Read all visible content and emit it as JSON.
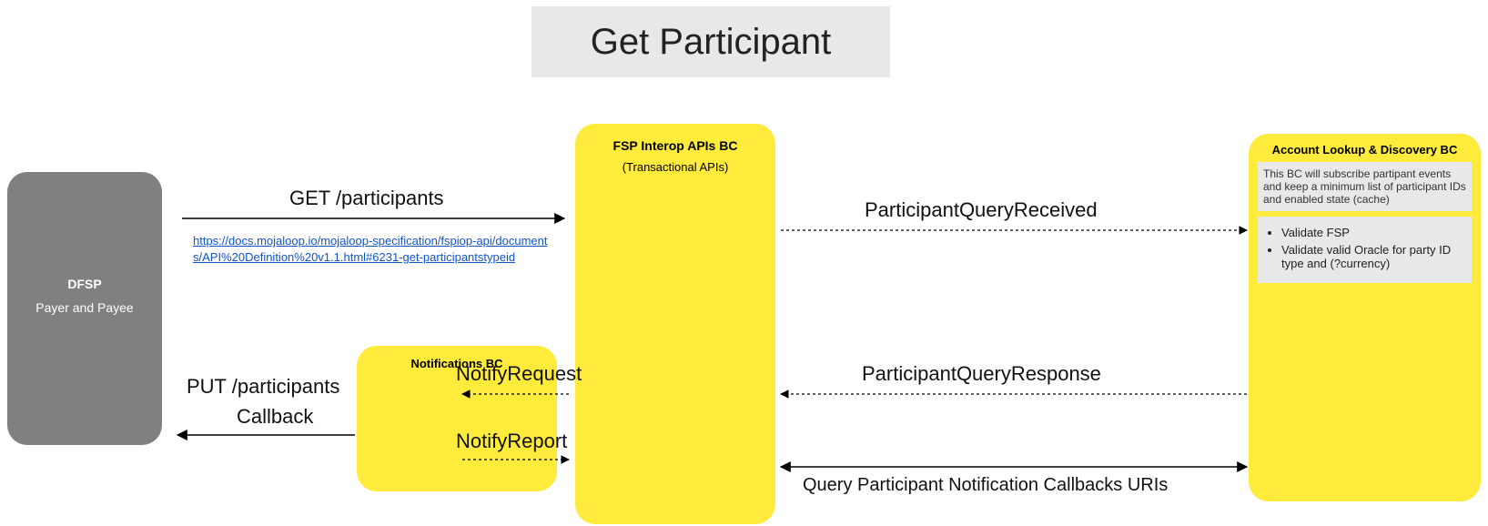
{
  "title": "Get Participant",
  "dfsp": {
    "name": "DFSP",
    "sub": "Payer and Payee"
  },
  "fsp": {
    "name": "FSP Interop APIs BC",
    "sub": "(Transactional APIs)"
  },
  "notif": {
    "name": "Notifications BC"
  },
  "ald": {
    "name": "Account Lookup & Discovery BC",
    "desc": "This BC will subscribe partipant events and keep a minimum list of participant IDs and enabled state (cache)",
    "bullets": [
      "Validate FSP",
      "Validate valid Oracle for party ID type and (?currency)"
    ]
  },
  "labels": {
    "get": "GET /participants",
    "link": "https://docs.mojaloop.io/mojaloop-specification/fspiop-api/documents/API%20Definition%20v1.1.html#6231-get-participantstypeid",
    "pqr": "ParticipantQueryReceived",
    "pqresp": "ParticipantQueryResponse",
    "qpncb": "Query Participant Notification Callbacks URIs",
    "nreq": "NotifyRequest",
    "nrep": "NotifyReport",
    "put": "PUT /participants",
    "cb": "Callback"
  }
}
